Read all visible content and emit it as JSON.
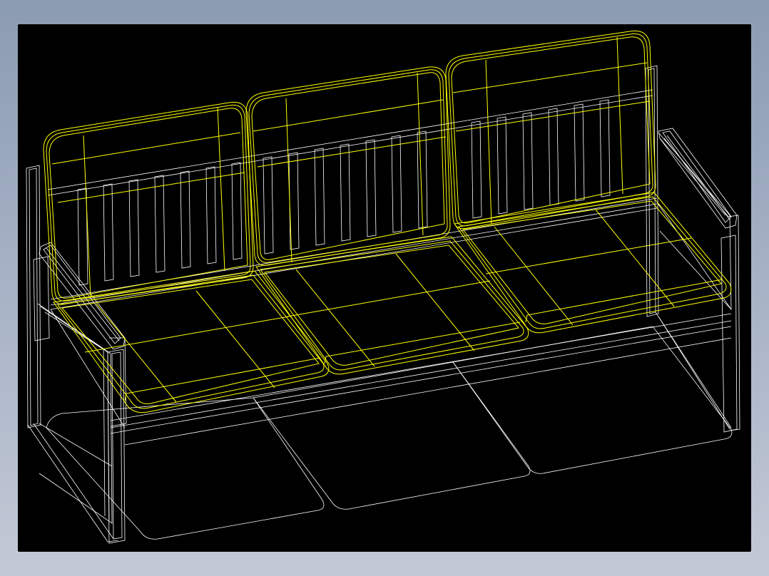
{
  "viewport": {
    "background": "#000000",
    "frame_background": "#8b9bb2",
    "model": "sofa-wireframe",
    "colors": {
      "frame_lines": "#ffffff",
      "cushion_lines": "#ffff00"
    },
    "cushion_count": 3
  }
}
